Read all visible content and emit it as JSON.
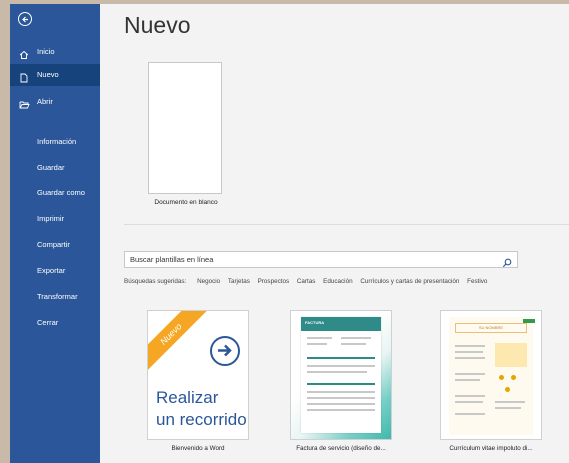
{
  "sidebar": {
    "items": [
      {
        "label": "Inicio",
        "icon": "home-icon"
      },
      {
        "label": "Nuevo",
        "icon": "new-document-icon",
        "active": true
      },
      {
        "label": "Abrir",
        "icon": "folder-open-icon"
      }
    ],
    "secondary": [
      "Información",
      "Guardar",
      "Guardar como",
      "Imprimir",
      "Compartir",
      "Exportar",
      "Transformar",
      "Cerrar"
    ]
  },
  "main": {
    "title": "Nuevo",
    "blank_label": "Documento en blanco",
    "search_placeholder": "Buscar plantillas en línea",
    "suggest_label": "Búsquedas sugeridas:",
    "suggestions": [
      "Negocio",
      "Tarjetas",
      "Prospectos",
      "Cartas",
      "Educación",
      "Currículos y cartas de presentación",
      "Festivo"
    ],
    "templates": [
      {
        "label": "Bienvenido a Word",
        "ribbon": "Nuevo",
        "text_line1": "Realizar",
        "text_line2": "un recorrido"
      },
      {
        "label": "Factura de servicio (diseño de...",
        "doc_title": "FACTURA"
      },
      {
        "label": "Currículum vitae impoluto di...",
        "doc_title": "SU NOMBRE"
      }
    ]
  },
  "colors": {
    "sidebar": "#2b579a",
    "accent": "#f5a623",
    "teal": "#3fb8ad"
  }
}
